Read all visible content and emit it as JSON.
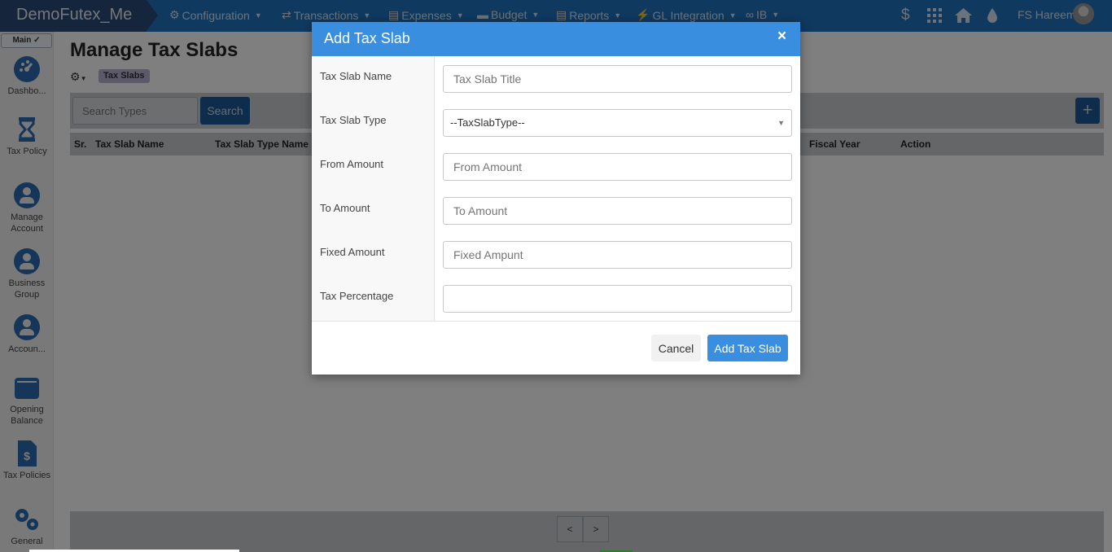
{
  "app": {
    "brand": "DemoFutex_Me",
    "nav": [
      {
        "icon": "gears-icon",
        "label": "Configuration"
      },
      {
        "icon": "transfer-icon",
        "label": "Transactions"
      },
      {
        "icon": "document-icon",
        "label": "Expenses"
      },
      {
        "icon": "wallet-icon",
        "label": "Budget"
      },
      {
        "icon": "document-icon",
        "label": "Reports"
      },
      {
        "icon": "plug-icon",
        "label": "GL Integration"
      },
      {
        "icon": "link-icon",
        "label": "IB"
      }
    ],
    "user_name": "FS Hareem"
  },
  "sidebar": {
    "main_tab": "Main ✓",
    "items": [
      {
        "label": "Dashbo...",
        "icon": "dashboard-icon"
      },
      {
        "label": "Tax Policy",
        "icon": "hourglass-icon"
      },
      {
        "label": "Manage Account",
        "icon": "user-circle-icon"
      },
      {
        "label": "Business Group",
        "icon": "user-circle-icon"
      },
      {
        "label": "Accoun...",
        "icon": "user-circle-icon"
      },
      {
        "label": "Opening Balance",
        "icon": "wallet-icon"
      },
      {
        "label": "Tax Policies",
        "icon": "invoice-dollar-icon"
      },
      {
        "label": "General",
        "icon": "gears-icon"
      }
    ]
  },
  "page": {
    "title": "Manage Tax Slabs",
    "breadcrumb": "Tax Slabs",
    "search_placeholder": "Search Types",
    "search_button": "Search",
    "add_button": "+",
    "table_headers": [
      "Sr.",
      "Tax Slab Name",
      "Tax Slab Type Name",
      "Fiscal Year",
      "Action"
    ],
    "pager_prev": "<",
    "pager_next": ">"
  },
  "modal": {
    "title": "Add Tax Slab",
    "close": "×",
    "fields": [
      {
        "label": "Tax Slab Name",
        "placeholder": "Tax Slab Title",
        "type": "text"
      },
      {
        "label": "Tax Slab Type",
        "value": "--TaxSlabType--",
        "type": "select"
      },
      {
        "label": "From Amount",
        "placeholder": "From Amount",
        "type": "text"
      },
      {
        "label": "To Amount",
        "placeholder": "To Amount",
        "type": "text"
      },
      {
        "label": "Fixed Amount",
        "placeholder": "Fixed Ampunt",
        "type": "text"
      },
      {
        "label": "Tax Percentage",
        "placeholder": "",
        "type": "text"
      }
    ],
    "cancel_button": "Cancel",
    "submit_button": "Add Tax Slab"
  }
}
